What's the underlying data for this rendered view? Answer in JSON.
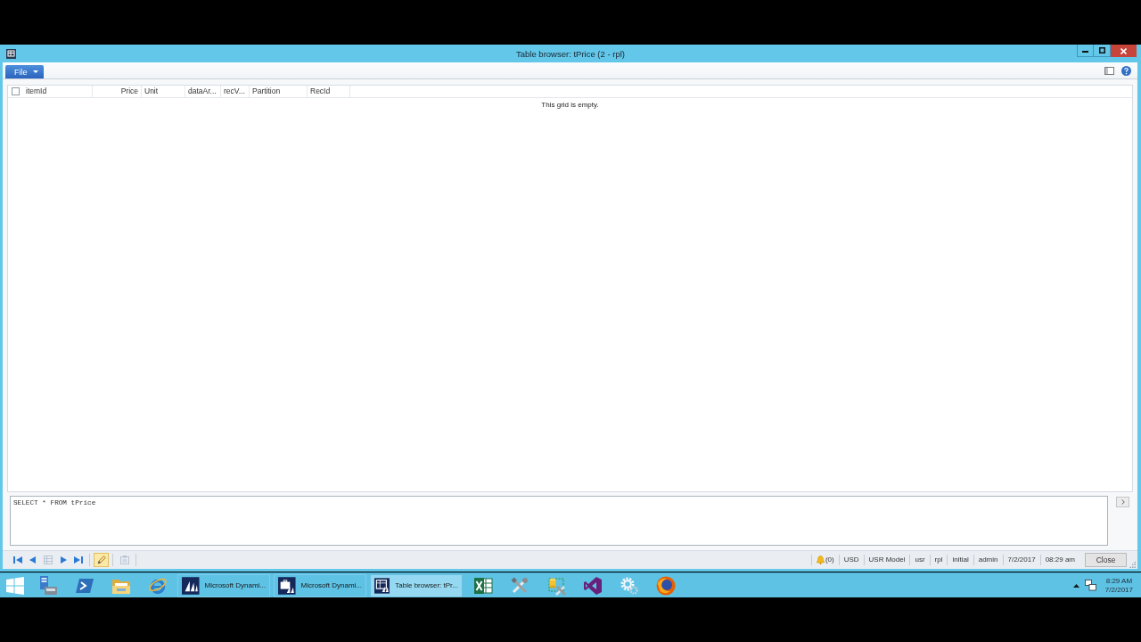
{
  "window": {
    "title": "Table browser: tPrice (2 - rpl)"
  },
  "menu": {
    "file_button": {
      "label": "File"
    }
  },
  "grid": {
    "select_all": {
      "checked": false
    },
    "columns": [
      {
        "label": "itemId",
        "kind": "text"
      },
      {
        "label": "Price",
        "kind": "number"
      },
      {
        "label": "Unit",
        "kind": "text"
      },
      {
        "label": "dataAr...",
        "kind": "text"
      },
      {
        "label": "recV...",
        "kind": "text"
      },
      {
        "label": "Partition",
        "kind": "text"
      },
      {
        "label": "RecId",
        "kind": "text"
      }
    ],
    "empty_message": "This grid is empty."
  },
  "query": {
    "value": "SELECT * FROM tPrice"
  },
  "status_bar": {
    "tools": [
      {
        "kind": "first",
        "on": false,
        "disabled": false
      },
      {
        "kind": "previous",
        "on": false,
        "disabled": false
      },
      {
        "kind": "list",
        "on": false,
        "disabled": true
      },
      {
        "kind": "next",
        "on": false,
        "disabled": false
      },
      {
        "kind": "last",
        "on": false,
        "disabled": false
      },
      {
        "kind": "edit",
        "on": true,
        "disabled": false
      },
      {
        "kind": "attach",
        "on": false,
        "disabled": true
      }
    ],
    "fields": [
      {
        "kind": "alerts",
        "text": "(0)"
      },
      {
        "kind": "text",
        "text": "USD"
      },
      {
        "kind": "text",
        "text": "USR Model"
      },
      {
        "kind": "text",
        "text": "usr"
      },
      {
        "kind": "text",
        "text": "rpl"
      },
      {
        "kind": "text",
        "text": "initial"
      },
      {
        "kind": "text",
        "text": "admin"
      },
      {
        "kind": "text",
        "text": "7/2/2017"
      },
      {
        "kind": "text",
        "text": "08:29 am"
      }
    ],
    "close_button": "Close"
  },
  "taskbar": {
    "items": [
      {
        "kind": "start"
      },
      {
        "kind": "computer"
      },
      {
        "kind": "terminal"
      },
      {
        "kind": "folder"
      },
      {
        "kind": "browser"
      },
      {
        "kind": "sails",
        "label": "Microsoft Dynami...",
        "selected": false
      },
      {
        "kind": "briefcase",
        "label": "Microsoft Dynami...",
        "selected": false
      },
      {
        "kind": "table",
        "label": "Table browser: tPr...",
        "selected": true
      },
      {
        "kind": "spreadsheet"
      },
      {
        "kind": "tools"
      },
      {
        "kind": "dbtools"
      },
      {
        "kind": "loop"
      },
      {
        "kind": "gears"
      },
      {
        "kind": "foxglobe"
      }
    ],
    "clock": {
      "time": "8:29 AM",
      "date": "7/2/2017"
    }
  }
}
